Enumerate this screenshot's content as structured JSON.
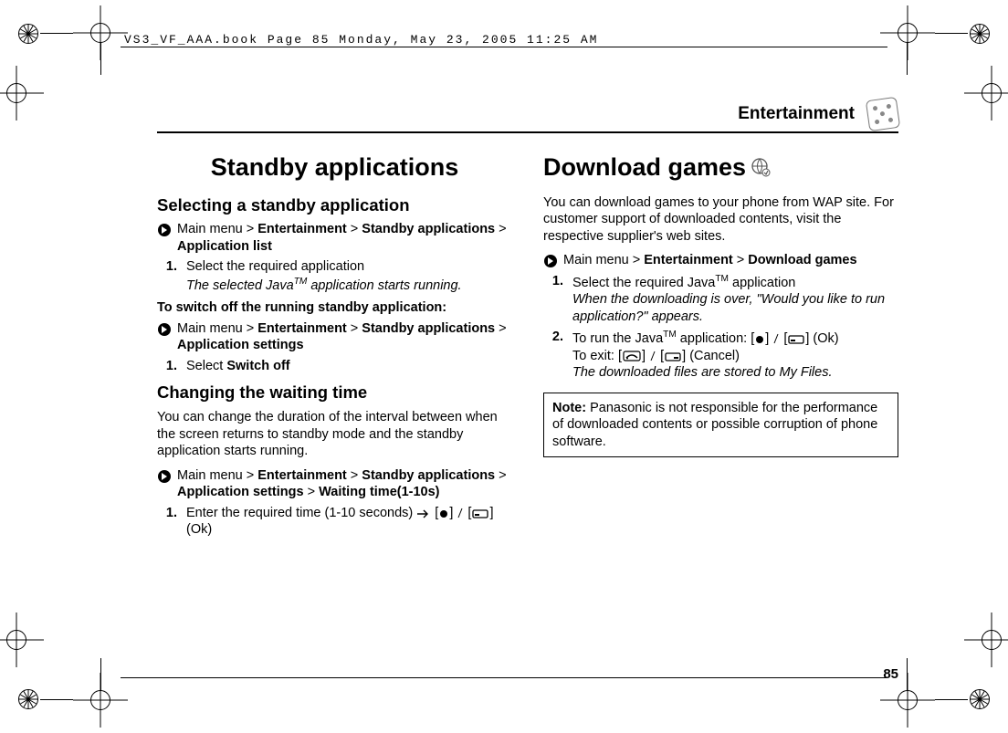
{
  "running_header": "VS3_VF_AAA.book  Page 85  Monday, May 23, 2005  11:25 AM",
  "section": "Entertainment",
  "page_number": "85",
  "left": {
    "h1": "Standby applications",
    "h2a": "Selecting a standby application",
    "crumb1_pre": "Main menu > ",
    "crumb1_b1": "Entertainment",
    "crumb1_b2": "Standby applications",
    "crumb1_b3": "Application list",
    "step1": "Select the required application",
    "step1_em": "The selected JavaTM application starts running.",
    "switch_heading": "To switch off the running standby application:",
    "crumb2_b3": "Application settings",
    "step2": "Select ",
    "step2_b": "Switch off",
    "h2b": "Changing the waiting time",
    "para_b": "You can change the duration of the interval between when the screen returns to standby mode and the standby application starts running.",
    "crumb3_b4": "Waiting time(1-10s)",
    "step3": "Enter the required time (1-10 seconds) ",
    "ok": " (Ok)"
  },
  "right": {
    "h1": "Download games",
    "intro": "You can download games to your phone from WAP site. For customer support of downloaded contents, visit the respective supplier's web sites.",
    "crumb_b3": "Download games",
    "step1_pre": "Select the required Java",
    "step1_post": " application",
    "step1_em": "When the downloading is over, \"Would you like to run application?\" appears.",
    "step2_pre": "To run the Java",
    "step2_post": " application: ",
    "step2_exit": "To exit: ",
    "cancel": " (Cancel)",
    "step2_em": "The downloaded files are stored to My Files.",
    "note_label": "Note:",
    "note_body": " Panasonic is not responsible for the performance of downloaded contents or possible corruption of phone software."
  },
  "sep": " > ",
  "num1": "1.",
  "num2": "2.",
  "tm": "TM"
}
